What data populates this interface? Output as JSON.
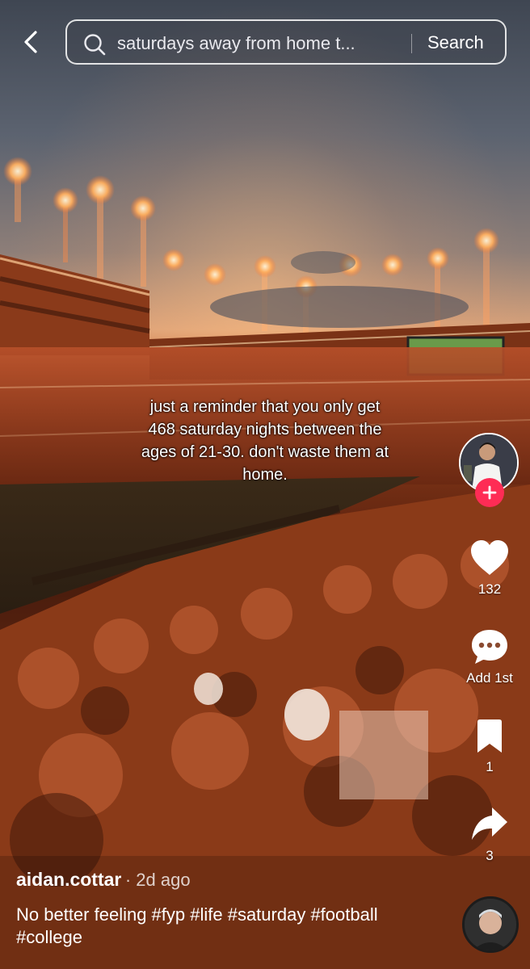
{
  "search": {
    "query": "saturdays away from home t...",
    "button_label": "Search"
  },
  "video": {
    "overlay_text": "just a reminder that you only get 468 saturday nights between the ages of 21-30. don't waste them at home."
  },
  "actions": {
    "likes": "132",
    "comments": "Add 1st",
    "saves": "1",
    "shares": "3"
  },
  "post": {
    "username": "aidan.cottar",
    "time": "· 2d ago",
    "caption": "No better feeling #fyp #life #saturday #football #college"
  },
  "icons": [
    "back-icon",
    "search-icon",
    "plus-icon",
    "heart-icon",
    "comment-icon",
    "bookmark-icon",
    "share-icon"
  ],
  "colors": {
    "follow_accent": "#fe2c55",
    "text": "#ffffff"
  }
}
